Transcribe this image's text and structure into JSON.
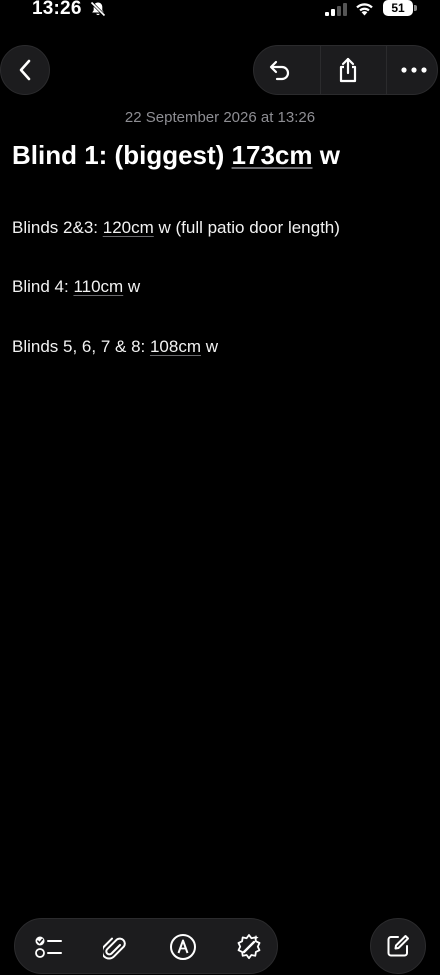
{
  "status_bar": {
    "time": "13:26",
    "battery": "51",
    "icons": [
      "bell-slash-icon",
      "cellular-signal-icon",
      "wifi-icon",
      "battery-icon"
    ]
  },
  "nav": {
    "back_icon": "chevron-left-icon",
    "undo_icon": "undo-icon",
    "share_icon": "share-icon",
    "more_icon": "more-horizontal-icon"
  },
  "note": {
    "date": "22 September 2026 at 13:26",
    "title": {
      "prefix": "Blind 1: (biggest) ",
      "measure": "173cm",
      "suffix": " w"
    },
    "lines": [
      {
        "prefix": "Blinds 2&3: ",
        "measure": "120cm",
        "suffix": " w (full patio door length)"
      },
      {
        "prefix": "Blind 4: ",
        "measure": "110cm",
        "suffix": " w"
      },
      {
        "prefix": "Blinds 5, 6, 7 & 8: ",
        "measure": "108cm",
        "suffix": " w"
      }
    ]
  },
  "toolbar": {
    "icons": [
      "checklist-icon",
      "paperclip-icon",
      "markup-pen-icon",
      "sparkle-writing-tools-icon"
    ],
    "compose_icon": "compose-icon"
  },
  "colors": {
    "background": "#000000",
    "button_background": "#1c1c1e",
    "secondary_text": "#8e8e93",
    "primary_text": "#ffffff"
  }
}
